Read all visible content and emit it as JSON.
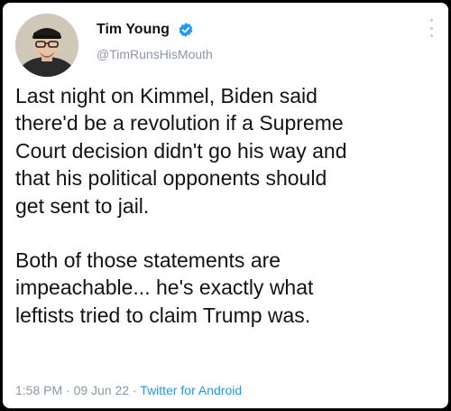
{
  "tweet": {
    "author": {
      "display_name": "Tim Young",
      "handle": "@TimRunsHisMouth",
      "verified": true
    },
    "paragraphs": [
      "Last night on Kimmel, Biden said\nthere'd be a revolution if a Supreme\nCourt decision didn't go his way and\nthat his political opponents should\nget sent to jail.",
      "Both of those statements are\nimpeachable... he's exactly what\nleftists tried to claim Trump was."
    ],
    "time": "1:58 PM",
    "separator": "·",
    "date": "09 Jun 22",
    "source": "Twitter for Android"
  },
  "icons": {
    "verified": "verified-badge-icon",
    "more": "more-options-icon"
  },
  "colors": {
    "background": "#000000",
    "card": "#ffffff",
    "text": "#0f1419",
    "secondary": "#8b98a5",
    "accent": "#1d9bf0"
  }
}
